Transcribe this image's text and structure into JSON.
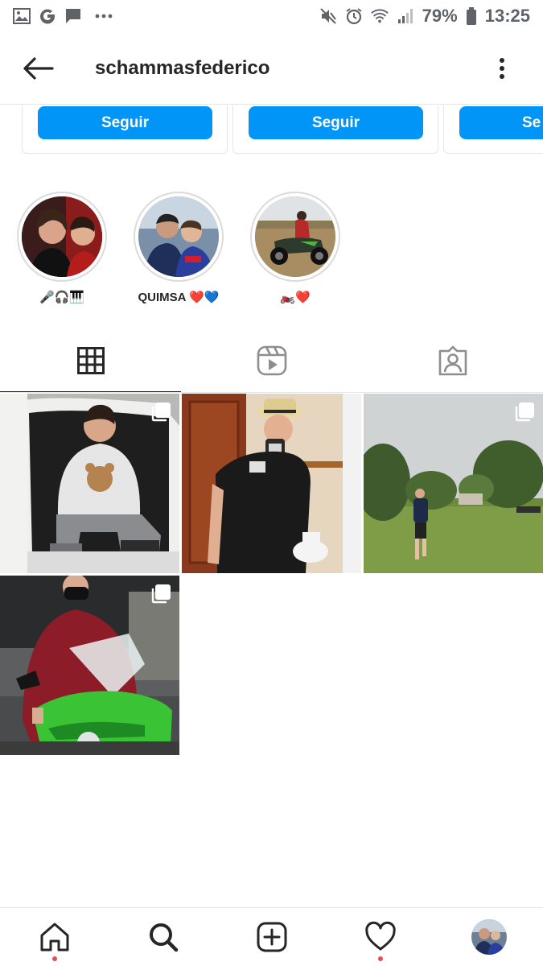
{
  "status_bar": {
    "battery": "79%",
    "time": "13:25",
    "left_icons": [
      "image-icon",
      "google-icon",
      "message-icon",
      "more-dots-icon"
    ],
    "right_icons": [
      "mute-icon",
      "alarm-icon",
      "wifi-icon",
      "signal-icon",
      "battery-icon"
    ]
  },
  "header": {
    "username": "schammasfederico",
    "back_icon": "arrow-left-icon",
    "more_icon": "more-vertical-icon"
  },
  "suggestions": {
    "follow_label": "Seguir",
    "follow_label_partial": "Se"
  },
  "highlights": [
    {
      "label": "🎤🎧🎹"
    },
    {
      "label": "QUIMSA ❤️💙"
    },
    {
      "label": "🏍️❤️"
    }
  ],
  "tabs": [
    {
      "name": "posts",
      "icon": "grid-icon",
      "active": true
    },
    {
      "name": "reels",
      "icon": "reels-icon",
      "active": false
    },
    {
      "name": "tagged",
      "icon": "tagged-icon",
      "active": false
    }
  ],
  "posts": [
    {
      "icon": "multiple-photos-icon"
    },
    {
      "icon": "multiple-photos-icon"
    },
    {
      "icon": "multiple-photos-icon"
    },
    {
      "icon": "multiple-photos-icon"
    }
  ],
  "bottom_nav": [
    {
      "name": "home",
      "icon": "home-icon",
      "notification_dot": true
    },
    {
      "name": "search",
      "icon": "search-icon",
      "notification_dot": false
    },
    {
      "name": "new-post",
      "icon": "add-post-icon",
      "notification_dot": false
    },
    {
      "name": "activity",
      "icon": "heart-icon",
      "notification_dot": true
    },
    {
      "name": "profile",
      "icon": "profile-avatar",
      "notification_dot": false
    }
  ],
  "colors": {
    "follow_button": "#0095f6",
    "notification_dot": "#ed4956",
    "text": "#262626",
    "border": "#e6e6e6"
  }
}
